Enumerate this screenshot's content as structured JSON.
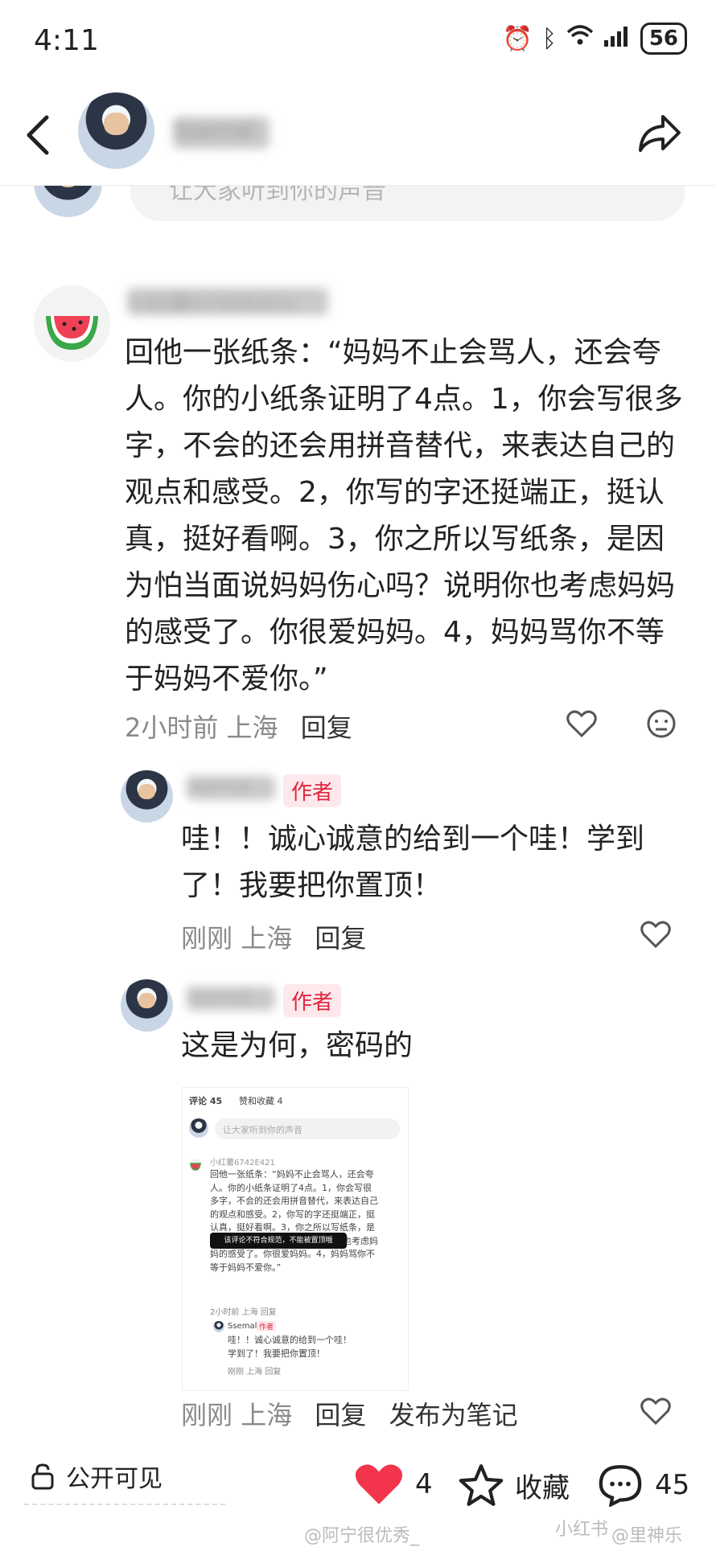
{
  "status_bar": {
    "time": "4:11",
    "battery": "56"
  },
  "header": {
    "author_name": "Ssemal"
  },
  "input_bar": {
    "placeholder": "让大家听到你的声音"
  },
  "comment1": {
    "username": "小红薯6742E421",
    "text": "回他一张纸条：“妈妈不止会骂人，还会夸人。你的小纸条证明了4点。1，你会写很多字，不会的还会用拼音替代，来表达自己的观点和感受。2，你写的字还挺端正，挺认真，挺好看啊。3，你之所以写纸条，是因为怕当面说妈妈伤心吗？说明你也考虑妈妈的感受了。你很爱妈妈。4，妈妈骂你不等于妈妈不爱你。”",
    "time": "2小时前",
    "location": "上海",
    "reply": "回复"
  },
  "reply1": {
    "username": "Ssemal",
    "badge": "作者",
    "text": "哇！！诚心诚意的给到一个哇！学到了！我要把你置顶！",
    "time": "刚刚",
    "location": "上海",
    "reply": "回复"
  },
  "reply2": {
    "username": "Ssemal",
    "badge": "作者",
    "text": "这是为何，密码的",
    "time": "刚刚",
    "location": "上海",
    "reply": "回复",
    "publish": "发布为笔记"
  },
  "screenshot": {
    "tab_comments": "评论 45",
    "tab_likes": "赞和收藏 4",
    "placeholder": "让大家听到你的声音",
    "username": "小红薯6742E421",
    "text": "回他一张纸条：“妈妈不止会骂人，还会夸人。你的小纸条证明了4点。1，你会写很多字，不会的还会用拼音替代，来表达自己的观点和感受。2，你写的字还挺端正，挺认真，挺好看啊。3，你之所以写纸条，是因为怕当面说妈妈伤心吗？说明你也考虑妈妈的感受了。你很爱妈妈。4，妈妈骂你不等于妈妈不爱你。”",
    "toast": "该评论不符合规范，不能被置顶哦",
    "time": "2小时前 上海 回复",
    "author": "Ssemal",
    "badge": "作者",
    "reply_text": "哇！！诚心诚意的给到一个哇！学到了！我要把你置顶！",
    "reply_time": "刚刚 上海 回复"
  },
  "bottom_bar": {
    "visibility": "公开可见",
    "likes": "4",
    "collect": "收藏",
    "comments": "45"
  },
  "watermarks": {
    "left": "@阿宁很优秀_",
    "right": "@里神乐",
    "brand": "小红书"
  },
  "colors": {
    "accent_red": "#e0253f",
    "heart_red": "#f2344c"
  }
}
